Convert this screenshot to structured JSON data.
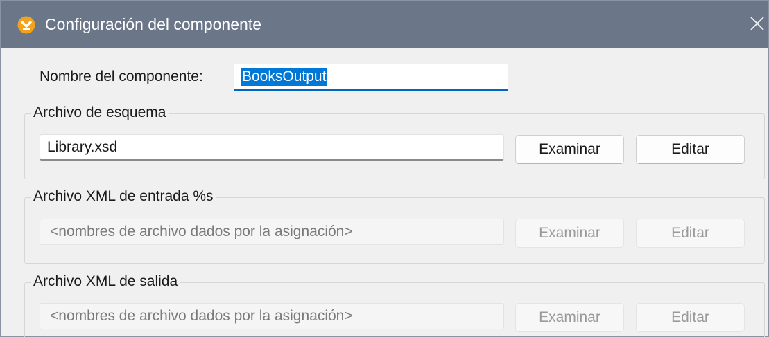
{
  "dialog": {
    "title": "Configuración del componente",
    "app_icon": "altova-mapforce-icon",
    "close_icon": "close-icon"
  },
  "component_name": {
    "label": "Nombre del componente:",
    "value": "BooksOutput",
    "selected": true
  },
  "schema_file": {
    "legend": "Archivo de esquema",
    "value": "Library.xsd",
    "browse_label": "Examinar",
    "edit_label": "Editar"
  },
  "input_xml": {
    "legend": "Archivo XML de entrada %s",
    "placeholder": "<nombres de archivo dados por la asignación>",
    "browse_label": "Examinar",
    "edit_label": "Editar",
    "enabled": false
  },
  "output_xml": {
    "legend": "Archivo XML de salida",
    "placeholder": "<nombres de archivo dados por la asignación>",
    "browse_label": "Examinar",
    "edit_label": "Editar",
    "enabled": false
  },
  "colors": {
    "titlebar": "#6b7789",
    "accent": "#0078d7",
    "icon_orange": "#f2a21b"
  }
}
